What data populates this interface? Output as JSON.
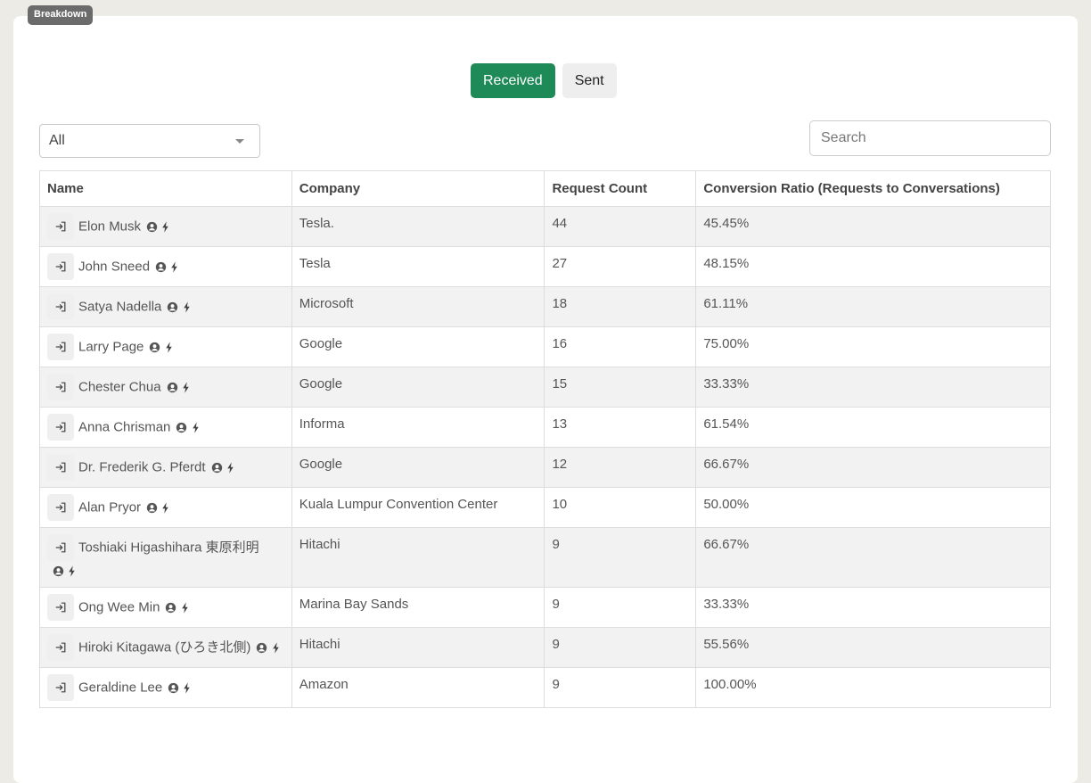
{
  "section": {
    "badge_label": "Breakdown"
  },
  "toggle": {
    "received_label": "Received",
    "sent_label": "Sent"
  },
  "filter": {
    "selected": "All"
  },
  "search": {
    "placeholder": "Search"
  },
  "table": {
    "headers": {
      "name": "Name",
      "company": "Company",
      "request_count": "Request Count",
      "conversion_ratio": "Conversion Ratio (Requests to Conversations)"
    },
    "rows": [
      {
        "name": "Elon Musk",
        "company": "Tesla.",
        "count": "44",
        "ratio": "45.45%"
      },
      {
        "name": "John Sneed",
        "company": "Tesla",
        "count": "27",
        "ratio": "48.15%"
      },
      {
        "name": "Satya Nadella",
        "company": "Microsoft",
        "count": "18",
        "ratio": "61.11%"
      },
      {
        "name": "Larry Page",
        "company": "Google",
        "count": "16",
        "ratio": "75.00%"
      },
      {
        "name": "Chester Chua",
        "company": "Google",
        "count": "15",
        "ratio": "33.33%"
      },
      {
        "name": "Anna Chrisman",
        "company": "Informa",
        "count": "13",
        "ratio": "61.54%"
      },
      {
        "name": "Dr. Frederik G. Pferdt",
        "company": "Google",
        "count": "12",
        "ratio": "66.67%"
      },
      {
        "name": "Alan Pryor",
        "company": "Kuala Lumpur Convention Center",
        "count": "10",
        "ratio": "50.00%"
      },
      {
        "name": "Toshiaki Higashihara 東原利明",
        "company": "Hitachi",
        "count": "9",
        "ratio": "66.67%"
      },
      {
        "name": "Ong Wee Min",
        "company": "Marina Bay Sands",
        "count": "9",
        "ratio": "33.33%"
      },
      {
        "name": "Hiroki Kitagawa (ひろき北側)",
        "company": "Hitachi",
        "count": "9",
        "ratio": "55.56%"
      },
      {
        "name": "Geraldine Lee",
        "company": "Amazon",
        "count": "9",
        "ratio": "100.00%"
      }
    ]
  },
  "icons": {
    "row_action": "sign-in-icon",
    "profile": "user-circle-icon",
    "activity": "lightning-bolt-icon"
  },
  "colors": {
    "accent": "#1e8a57",
    "badge": "#6b6b6b"
  }
}
